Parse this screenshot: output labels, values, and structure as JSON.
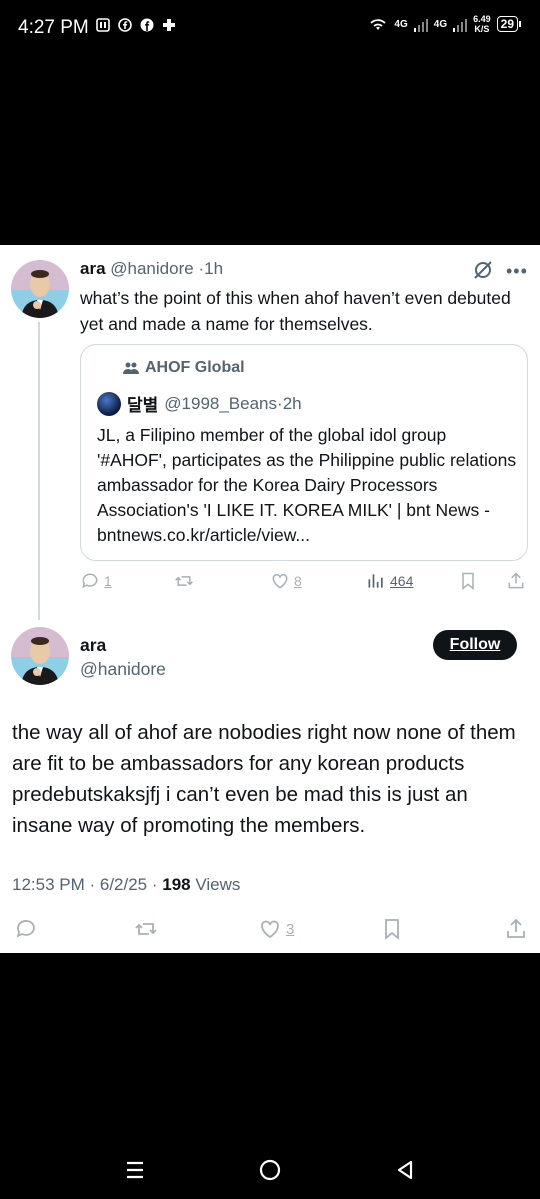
{
  "status_bar": {
    "time": "4:27 PM",
    "net1": "4G",
    "net2": "4G",
    "speed_value": "6.49",
    "speed_unit": "K/S",
    "battery": "29"
  },
  "tweet1": {
    "name": "ara",
    "handle": "@hanidore",
    "time": "1h",
    "text": "what’s the point of this when ahof haven’t even debuted yet and made a name for themselves.",
    "quote": {
      "community": "AHOF Global",
      "author_name": "달별",
      "author_handle": "@1998_Beans",
      "time": "2h",
      "text": "JL, a Filipino member of the global idol group '#AHOF', participates as the Philippine public relations ambassador for the Korea Dairy Processors Association's 'I LIKE IT. KOREA MILK' | bnt News - bntnews.co.kr/article/view..."
    },
    "actions": {
      "replies": "1",
      "reposts": "",
      "likes": "8",
      "views": "464"
    }
  },
  "tweet2": {
    "name": "ara",
    "handle": "@hanidore",
    "follow_label": "Follow",
    "text": "the way all of ahof are nobodies right now none of them are fit to be ambassadors for any korean products predebutskaksjfj i can’t even be mad this is just an insane way of promoting the members.",
    "timestamp": "12:53 PM · 6/2/25 ·",
    "views_count": "198",
    "views_label": "Views",
    "actions": {
      "likes": "3"
    }
  },
  "colors": {
    "text": "#0f1419",
    "secondary": "#536471",
    "border": "#cfd9de",
    "follow_bg": "#0f1419"
  },
  "icons": [
    "wifi-icon",
    "grok-icon",
    "more-icon",
    "reply-icon",
    "repost-icon",
    "like-icon",
    "views-icon",
    "bookmark-icon",
    "share-icon",
    "community-icon",
    "recents-icon",
    "home-icon",
    "back-icon"
  ]
}
